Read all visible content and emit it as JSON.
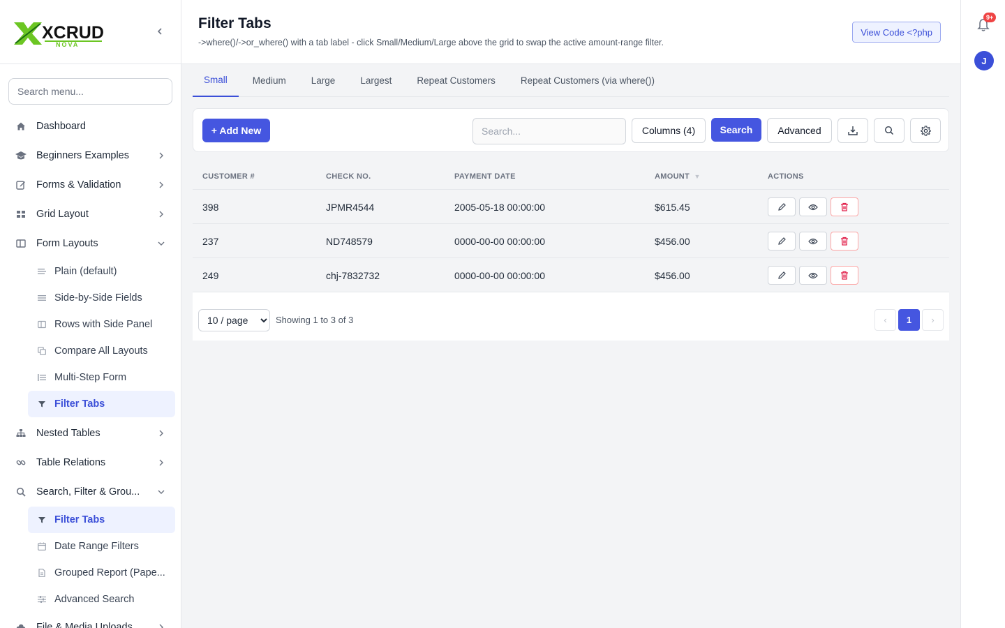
{
  "sidebar": {
    "logo_text": "XCRUD",
    "logo_sub": "NOVA",
    "search_placeholder": "Search menu...",
    "items": [
      {
        "label": "Dashboard",
        "icon": "home-icon"
      },
      {
        "label": "Beginners Examples",
        "icon": "graduation-cap-icon"
      },
      {
        "label": "Forms & Validation",
        "icon": "edit-icon"
      },
      {
        "label": "Grid Layout",
        "icon": "grid-icon"
      },
      {
        "label": "Form Layouts",
        "icon": "columns-icon"
      },
      {
        "label": "Nested Tables",
        "icon": "sitemap-icon"
      },
      {
        "label": "Table Relations",
        "icon": "link-icon"
      },
      {
        "label": "Search, Filter & Grou...",
        "icon": "search-icon"
      },
      {
        "label": "File & Media Uploads",
        "icon": "cloud-upload-icon"
      }
    ],
    "form_layouts_sub": [
      {
        "label": "Plain (default)"
      },
      {
        "label": "Side-by-Side Fields"
      },
      {
        "label": "Rows with Side Panel"
      },
      {
        "label": "Compare All Layouts"
      },
      {
        "label": "Multi-Step Form"
      },
      {
        "label": "Filter Tabs"
      }
    ],
    "search_sub": [
      {
        "label": "Filter Tabs"
      },
      {
        "label": "Date Range Filters"
      },
      {
        "label": "Grouped Report (Pape..."
      },
      {
        "label": "Advanced Search"
      }
    ]
  },
  "header": {
    "title": "Filter Tabs",
    "subtitle": "->where()/->or_where() with a tab label - click Small/Medium/Large above the grid to swap the active amount-range filter.",
    "view_code": "View Code <?php"
  },
  "rail": {
    "badge": "9+",
    "avatar": "J"
  },
  "tabs": [
    "Small",
    "Medium",
    "Large",
    "Largest",
    "Repeat Customers",
    "Repeat Customers (via where())"
  ],
  "toolbar": {
    "add_label": "+ Add New",
    "search_placeholder": "Search...",
    "columns_label": "Columns (4)",
    "search_label": "Search",
    "advanced_label": "Advanced"
  },
  "table": {
    "headers": [
      "CUSTOMER #",
      "CHECK NO.",
      "PAYMENT DATE",
      "AMOUNT",
      "ACTIONS"
    ],
    "sort_indicator": "▼",
    "rows": [
      [
        "398",
        "JPMR4544",
        "2005-05-18 00:00:00",
        "$615.45"
      ],
      [
        "237",
        "ND748579",
        "0000-00-00 00:00:00",
        "$456.00"
      ],
      [
        "249",
        "chj-7832732",
        "0000-00-00 00:00:00",
        "$456.00"
      ]
    ]
  },
  "pager": {
    "per_page": "10 / page",
    "showing": "Showing 1 to 3 of 3",
    "prev": "‹",
    "current": "1",
    "next": "›"
  },
  "colors": {
    "accent": "#4556e0",
    "active_bg": "#eef2ff",
    "danger": "#e11d48"
  }
}
